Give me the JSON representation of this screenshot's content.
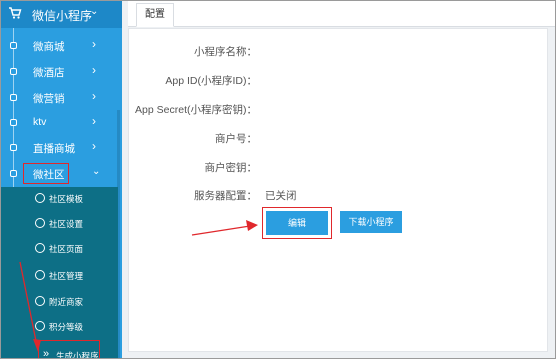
{
  "sidebar": {
    "header_title": "微信小程序",
    "items": [
      {
        "label": "微商城"
      },
      {
        "label": "微酒店"
      },
      {
        "label": "微营销"
      },
      {
        "label": "ktv"
      },
      {
        "label": "直播商城"
      },
      {
        "label": "微社区"
      }
    ],
    "subitems": [
      {
        "label": "社区模板"
      },
      {
        "label": "社区设置"
      },
      {
        "label": "社区页面"
      },
      {
        "label": "社区管理"
      },
      {
        "label": "附近商家"
      },
      {
        "label": "积分等级"
      },
      {
        "label": "生成小程序",
        "prefix": "»"
      }
    ]
  },
  "tabs": [
    {
      "label": "配置"
    }
  ],
  "form": {
    "fields": [
      {
        "label": "小程序名称：",
        "value": ""
      },
      {
        "label": "App ID(小程序ID)：",
        "value": ""
      },
      {
        "label": "App Secret(小程序密钥)：",
        "value": ""
      },
      {
        "label": "商户号：",
        "value": ""
      },
      {
        "label": "商户密钥：",
        "value": ""
      },
      {
        "label": "服务器配置：",
        "value": "已关闭"
      }
    ],
    "edit_button": "编辑",
    "download_button": "下载小程序"
  },
  "colors": {
    "sidebar": "#2b9ee0",
    "submenu": "#0d6f86",
    "button": "#2b9ee0",
    "annotation": "#e0282c"
  }
}
